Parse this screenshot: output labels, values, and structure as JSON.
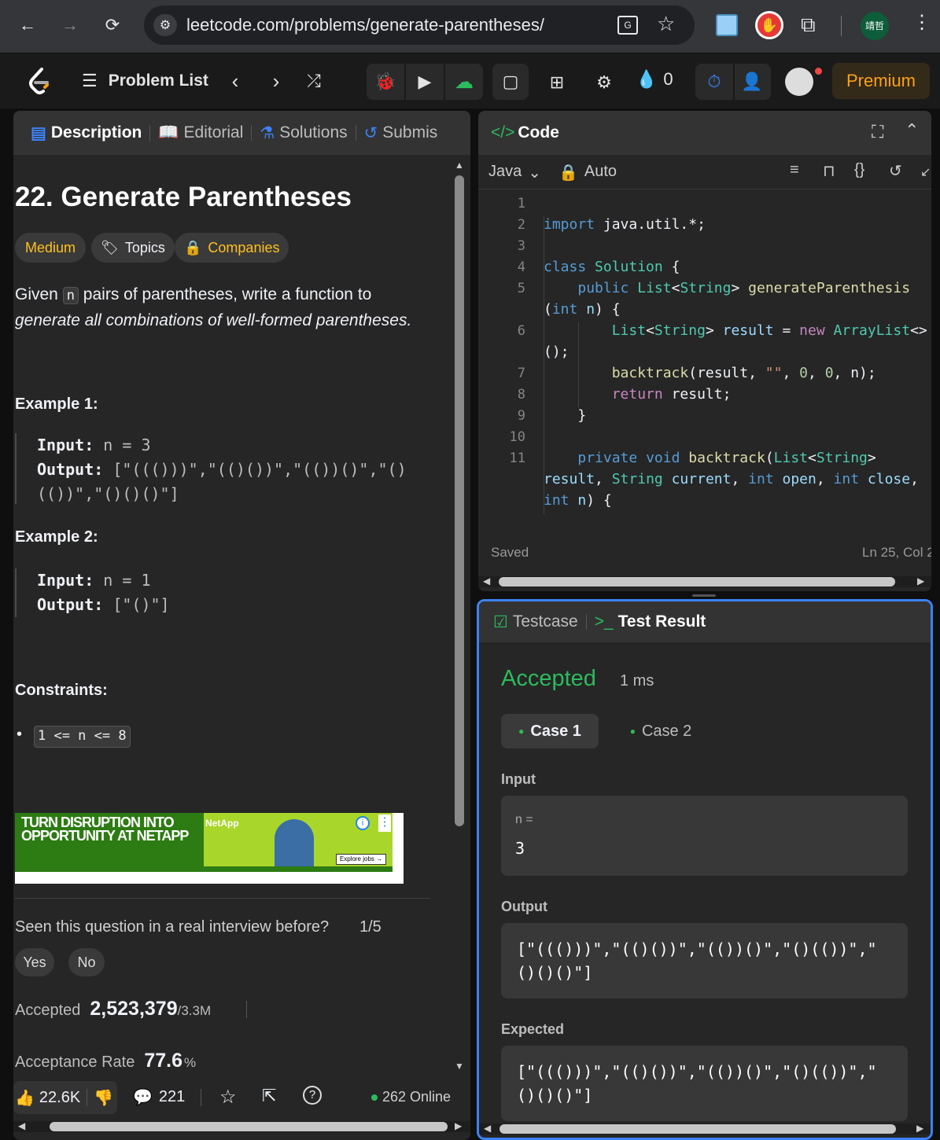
{
  "browser": {
    "url": "leetcode.com/problems/generate-parentheses/",
    "profile": "靖哲"
  },
  "nav": {
    "problem_list": "Problem List",
    "streak": "0",
    "premium": "Premium"
  },
  "left": {
    "tabs": [
      "Description",
      "Editorial",
      "Solutions",
      "Submis"
    ],
    "title": "22. Generate Parentheses",
    "tags": {
      "difficulty": "Medium",
      "topics": "Topics",
      "companies": "Companies"
    },
    "desc_pre": "Given",
    "desc_code": "n",
    "desc_mid": "pairs of parentheses, write a function to",
    "desc_em": "generate all combinations of well-formed parentheses.",
    "example1_title": "Example 1:",
    "ex1_input_label": "Input:",
    "ex1_input": "n = 3",
    "ex1_output_label": "Output:",
    "ex1_output_a": "[\"((()))\",\"(()())\",\"(())()\",\"()",
    "ex1_output_b": "(())\",\"()()()\"]",
    "example2_title": "Example 2:",
    "ex2_input_label": "Input:",
    "ex2_input": "n = 1",
    "ex2_output_label": "Output:",
    "ex2_output": "[\"()\"]",
    "constraints_title": "Constraints:",
    "constraint": "1 <= n <= 8",
    "ad_line1": "TURN DISRUPTION INTO",
    "ad_line2": "OPPORTUNITY AT NETAPP",
    "ad_brand": "NetApp",
    "ad_cta": "Explore jobs →",
    "seen_q": "Seen this question in a real interview before?",
    "seen_count": "1/5",
    "yes": "Yes",
    "no": "No",
    "accepted_label": "Accepted",
    "accepted_value": "2,523,379",
    "accepted_total": "/3.3M",
    "rate_label": "Acceptance Rate",
    "rate_value": "77.6",
    "rate_unit": "%",
    "likes": "22.6K",
    "comments": "221",
    "online": "262 Online"
  },
  "code": {
    "tab": "Code",
    "language": "Java",
    "mode": "Auto",
    "status": "Saved",
    "position": "Ln 25, Col 2"
  },
  "result": {
    "tab_testcase": "Testcase",
    "tab_result": "Test Result",
    "verdict": "Accepted",
    "runtime": "1 ms",
    "case1": "Case 1",
    "case2": "Case 2",
    "input_label": "Input",
    "input_var": "n =",
    "input_value": "3",
    "output_label": "Output",
    "output_a": "[\"((()))\",\"(()())\",\"(())()\",\"()(())\",\"",
    "output_b": "()()()\"]",
    "expected_label": "Expected",
    "expected_a": "[\"((()))\",\"(()())\",\"(())()\",\"()(())\",\"",
    "expected_b": "()()()\"]"
  },
  "colors": {
    "accepted": "#2cbb5d",
    "medium": "#ffc01e",
    "focus": "#3b82f6"
  }
}
